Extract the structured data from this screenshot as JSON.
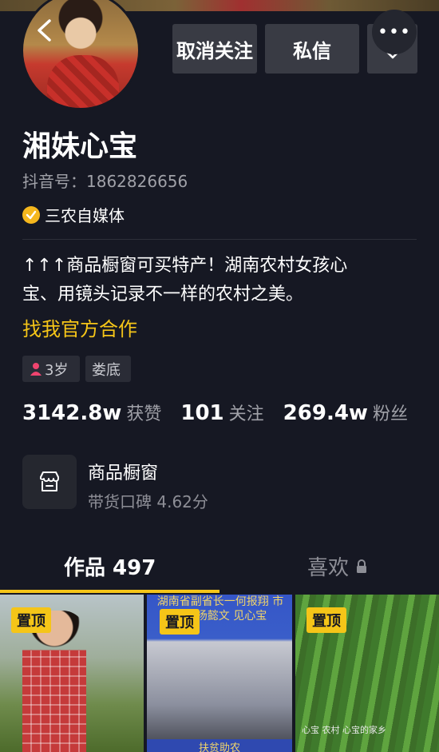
{
  "header": {
    "unfollow_label": "取消关注",
    "message_label": "私信",
    "more_dots": "•••"
  },
  "profile": {
    "name": "湘妹心宝",
    "douyin_id": "抖音号：1862826656",
    "certification": "三农自媒体",
    "bio_line1": "↑↑↑商品橱窗可买特产！湖南农村女孩心",
    "bio_line2": "宝、用镜头记录不一样的农村之美。",
    "bio_link": "找我官方合作",
    "tags": {
      "age": "3岁",
      "city": "娄底"
    }
  },
  "stats": {
    "likes_value": "3142.8w",
    "likes_label": "获赞",
    "following_value": "101",
    "following_label": "关注",
    "followers_value": "269.4w",
    "followers_label": "粉丝"
  },
  "shop": {
    "title": "商品橱窗",
    "subtitle": "带货口碑 4.62分"
  },
  "tabs": {
    "works_label": "作品 497",
    "likes_label": "喜欢"
  },
  "videos": [
    {
      "pin": "置顶"
    },
    {
      "pin": "置顶",
      "caption_top": "湖南省副省长一何报翔 市长一杨懿文 见心宝",
      "caption_bottom": "扶贫助农"
    },
    {
      "pin": "置顶",
      "caption": "心宝 农村 心宝的家乡"
    }
  ],
  "colors": {
    "background": "#161823",
    "accent": "#f5c518",
    "button": "#393b44",
    "certification": "#f5b71d"
  },
  "icons": {
    "back": "chevron-left-icon",
    "more": "more-dots-icon",
    "dropdown": "chevron-down-icon",
    "cert": "check-badge-icon",
    "gender": "female-icon",
    "shop": "storefront-icon",
    "lock": "lock-icon"
  }
}
